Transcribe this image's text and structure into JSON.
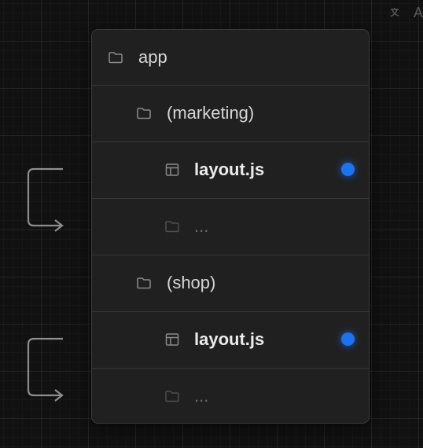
{
  "corner": {
    "label": "A"
  },
  "tree": {
    "items": [
      {
        "label": "app",
        "icon": "folder-icon"
      },
      {
        "label": "(marketing)",
        "icon": "folder-icon"
      },
      {
        "label": "layout.js",
        "icon": "layout-icon",
        "marker": true
      },
      {
        "label": "...",
        "icon": "folder-icon"
      },
      {
        "label": "(shop)",
        "icon": "folder-icon"
      },
      {
        "label": "layout.js",
        "icon": "layout-icon",
        "marker": true
      },
      {
        "label": "...",
        "icon": "folder-icon"
      }
    ]
  },
  "colors": {
    "marker": "#1a74f0",
    "background": "#111111",
    "panel": "#202020"
  }
}
